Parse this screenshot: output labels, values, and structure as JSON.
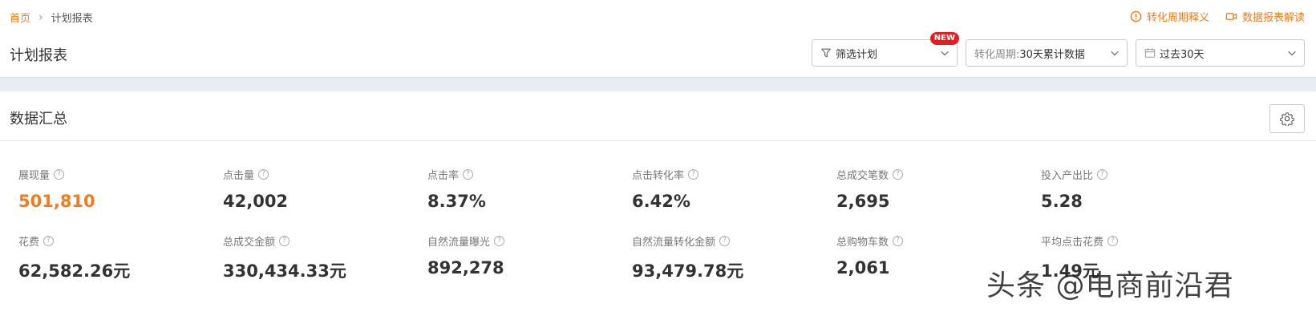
{
  "breadcrumb": {
    "home": "首页",
    "current": "计划报表"
  },
  "top_links": {
    "conversion_cycle": "转化周期释义",
    "report_guide": "数据报表解读"
  },
  "page_title": "计划报表",
  "filters": {
    "plan_filter": {
      "label": "筛选计划",
      "badge": "NEW"
    },
    "cycle": {
      "label": "转化周期:",
      "value": "30天累计数据"
    },
    "date_range": {
      "value": "过去30天"
    }
  },
  "summary": {
    "title": "数据汇总"
  },
  "metrics": [
    {
      "label": "展现量",
      "value": "501,810"
    },
    {
      "label": "点击量",
      "value": "42,002"
    },
    {
      "label": "点击率",
      "value": "8.37%"
    },
    {
      "label": "点击转化率",
      "value": "6.42%"
    },
    {
      "label": "总成交笔数",
      "value": "2,695"
    },
    {
      "label": "投入产出比",
      "value": "5.28"
    },
    {
      "label": "花费",
      "value": "62,582.26元"
    },
    {
      "label": "总成交金额",
      "value": "330,434.33元"
    },
    {
      "label": "自然流量曝光",
      "value": "892,278"
    },
    {
      "label": "自然流量转化金额",
      "value": "93,479.78元"
    },
    {
      "label": "总购物车数",
      "value": "2,061"
    },
    {
      "label": "平均点击花费",
      "value": "1.49元"
    }
  ],
  "watermark": "头条 @电商前沿君",
  "colors": {
    "accent": "#f37b1d",
    "badge": "#e02020",
    "band": "#e8ecf3"
  }
}
